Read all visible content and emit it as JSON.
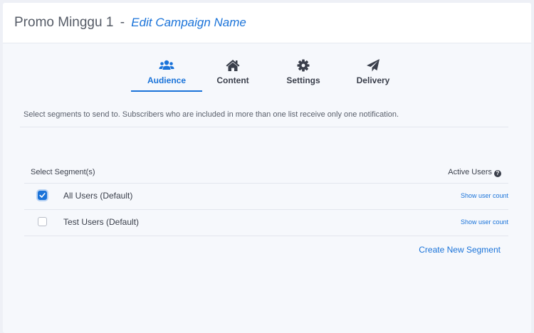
{
  "campaign": {
    "name": "Promo Minggu 1",
    "separator": "-",
    "edit_label": "Edit Campaign Name"
  },
  "tabs": [
    {
      "label": "Audience",
      "icon": "users-icon",
      "active": true
    },
    {
      "label": "Content",
      "icon": "home-icon",
      "active": false
    },
    {
      "label": "Settings",
      "icon": "gear-icon",
      "active": false
    },
    {
      "label": "Delivery",
      "icon": "paper-plane-icon",
      "active": false
    }
  ],
  "instruction": "Select segments to send to. Subscribers who are included in more than one list receive only one notification.",
  "segments_table": {
    "header_left": "Select Segment(s)",
    "header_right": "Active Users",
    "rows": [
      {
        "label": "All Users (Default)",
        "checked": true,
        "link": "Show user count"
      },
      {
        "label": "Test Users (Default)",
        "checked": false,
        "link": "Show user count"
      }
    ]
  },
  "create_segment_label": "Create New Segment",
  "colors": {
    "accent": "#1a73d9",
    "text": "#3a3f4b",
    "background": "#f6f8fc"
  }
}
